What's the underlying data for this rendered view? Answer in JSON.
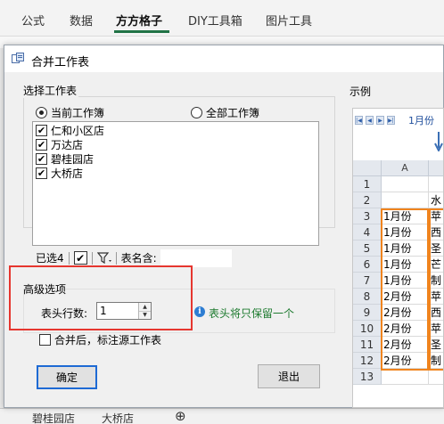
{
  "ribbon": {
    "tabs": [
      "公式",
      "数据",
      "方方格子",
      "DIY工具箱",
      "图片工具"
    ],
    "active_tab": "方方格子",
    "accent": "#217346"
  },
  "sheet_tabs": [
    "碧桂园店",
    "大桥店"
  ],
  "dialog": {
    "title": "合并工作表",
    "select_group_title": "选择工作表",
    "radio_current": "当前工作簿",
    "radio_all": "全部工作簿",
    "selected_radio": "current",
    "sheets": [
      {
        "name": "仁和小区店",
        "checked": true
      },
      {
        "name": "万达店",
        "checked": true
      },
      {
        "name": "碧桂园店",
        "checked": true
      },
      {
        "name": "大桥店",
        "checked": true
      }
    ],
    "selected_count_label": "已选4",
    "sheet_name_label": "表名含:",
    "sheet_name_value": "",
    "advanced_title": "高级选项",
    "header_rows_label": "表头行数:",
    "header_rows_value": "1",
    "info_text": "表头将只保留一个",
    "annotate_label": "合并后，标注源工作表",
    "annotate_checked": false,
    "ok_label": "确定",
    "exit_label": "退出",
    "highlight_color": "#e6362f"
  },
  "example": {
    "title": "示例",
    "tab_label": "1月份",
    "col_a": "A",
    "rows": [
      {
        "num": "1",
        "a": "",
        "b": ""
      },
      {
        "num": "2",
        "a": "",
        "b": "水"
      },
      {
        "num": "3",
        "a": "1月份",
        "b": "苹"
      },
      {
        "num": "4",
        "a": "1月份",
        "b": "西"
      },
      {
        "num": "5",
        "a": "1月份",
        "b": "圣"
      },
      {
        "num": "6",
        "a": "1月份",
        "b": "芒"
      },
      {
        "num": "7",
        "a": "1月份",
        "b": "制"
      },
      {
        "num": "8",
        "a": "2月份",
        "b": "苹"
      },
      {
        "num": "9",
        "a": "2月份",
        "b": "西"
      },
      {
        "num": "10",
        "a": "2月份",
        "b": "苹"
      },
      {
        "num": "11",
        "a": "2月份",
        "b": "圣"
      },
      {
        "num": "12",
        "a": "2月份",
        "b": "制"
      },
      {
        "num": "13",
        "a": "",
        "b": ""
      }
    ],
    "highlight_color": "#f0841e"
  }
}
